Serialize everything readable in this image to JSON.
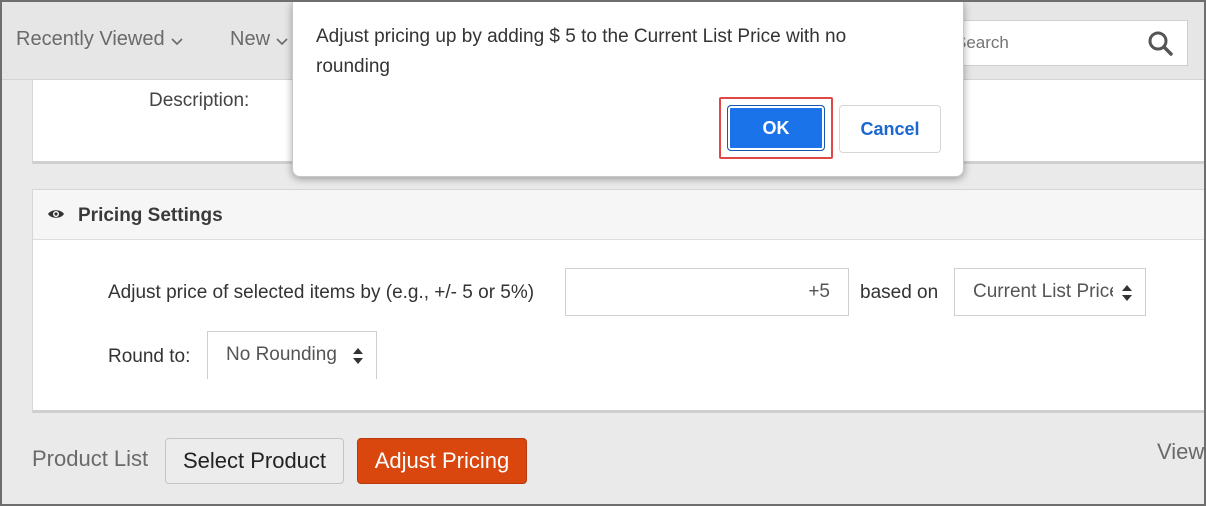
{
  "topnav": {
    "items": [
      {
        "label": "Recently Viewed"
      },
      {
        "label": "New"
      }
    ],
    "search": {
      "placeholder": "Search"
    }
  },
  "description": {
    "label": "Description:"
  },
  "pricing": {
    "title": "Pricing Settings",
    "adjust_label": "Adjust price of selected items by (e.g., +/- 5 or 5%)",
    "adjust_value": "+5",
    "based_on_label": "based on",
    "based_on_value": "Current List Price",
    "round_label": "Round to:",
    "round_value": "No Rounding"
  },
  "bottom": {
    "product_list_label": "Product List",
    "select_product_button": "Select Product",
    "adjust_pricing_button": "Adjust Pricing",
    "view_label": "View"
  },
  "dialog": {
    "message": "Adjust pricing up by adding $ 5 to the Current List Price with no rounding",
    "ok_label": "OK",
    "cancel_label": "Cancel"
  },
  "colors": {
    "accent_orange": "#d9470f",
    "ok_blue": "#1a73e8",
    "highlight_red": "#e04848"
  }
}
